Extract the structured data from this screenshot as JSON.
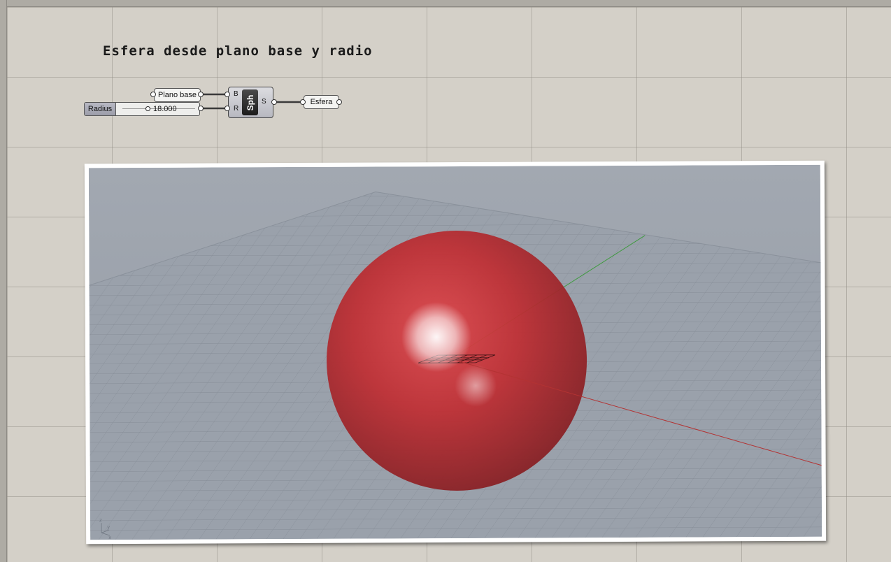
{
  "canvas": {
    "background": "#d4d0c8",
    "group_title": "Esfera desde plano base y radio"
  },
  "nodes": {
    "plane_param": {
      "label": "Plano base"
    },
    "radius_slider": {
      "name": "Radius",
      "value": "18.000",
      "value_fraction": 0.3
    },
    "sphere_component": {
      "nickname": "Sph",
      "input_base": "B",
      "input_radius": "R",
      "output": "S"
    },
    "output_param": {
      "label": "Esfera"
    }
  },
  "viewport": {
    "background": "#9ca3ad",
    "sphere_color": "#b0272b",
    "axis_x_color": "#b33333",
    "axis_y_color": "#3e9a3e",
    "gizmo_labels": {
      "z": "z",
      "y": "y",
      "x": "x"
    }
  }
}
